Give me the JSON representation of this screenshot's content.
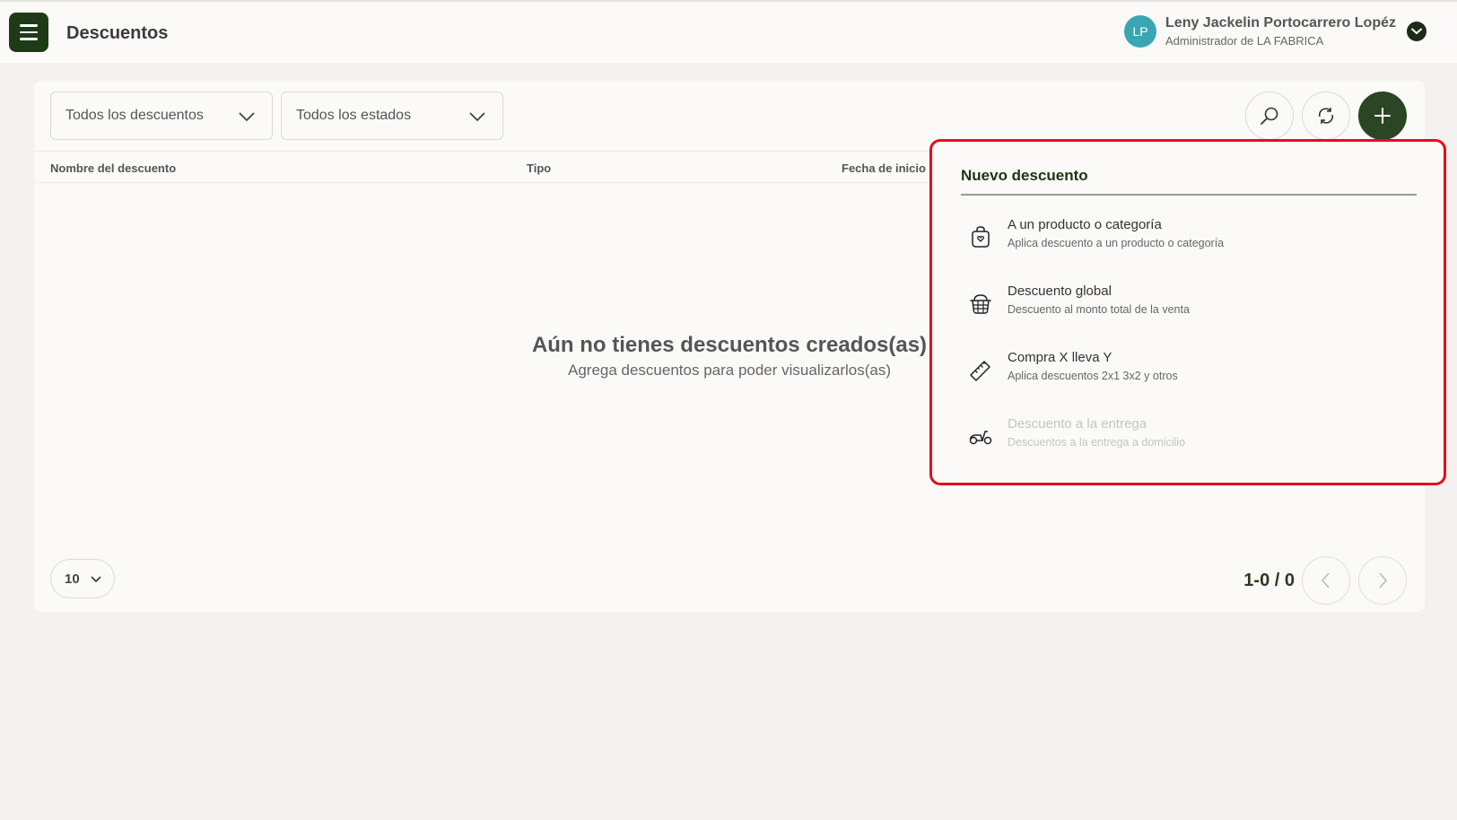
{
  "header": {
    "title": "Descuentos",
    "user": {
      "initials": "LP",
      "name": "Leny Jackelin Portocarrero Lopéz",
      "role": "Administrador de LA FABRICA"
    }
  },
  "filters": {
    "discounts": "Todos los descuentos",
    "states": "Todos los estados"
  },
  "table": {
    "columns": [
      "Nombre del descuento",
      "Tipo",
      "Fecha de inicio"
    ]
  },
  "empty_state": {
    "title": "Aún no tienes descuentos creados(as)",
    "subtitle": "Agrega descuentos para poder visualizarlos(as)"
  },
  "pagination": {
    "page_size": "10",
    "range": "1-0 / 0"
  },
  "popup": {
    "title": "Nuevo descuento",
    "options": [
      {
        "title": "A un producto o categoría",
        "desc": "Aplica descuento a un producto o categoría",
        "icon": "shopping-bag-icon",
        "enabled": true
      },
      {
        "title": "Descuento global",
        "desc": "Descuento al monto total de la venta",
        "icon": "basket-icon",
        "enabled": true
      },
      {
        "title": "Compra X lleva Y",
        "desc": "Aplica descuentos 2x1 3x2 y otros",
        "icon": "ruler-icon",
        "enabled": true
      },
      {
        "title": "Descuento a la entrega",
        "desc": "Descuentos a la entrega a domicilio",
        "icon": "scooter-icon",
        "enabled": false
      }
    ]
  },
  "colors": {
    "primary": "#2c4525",
    "menu_button": "#1f3a16",
    "avatar": "#3aa6b3",
    "highlight_border": "#e0101a"
  }
}
